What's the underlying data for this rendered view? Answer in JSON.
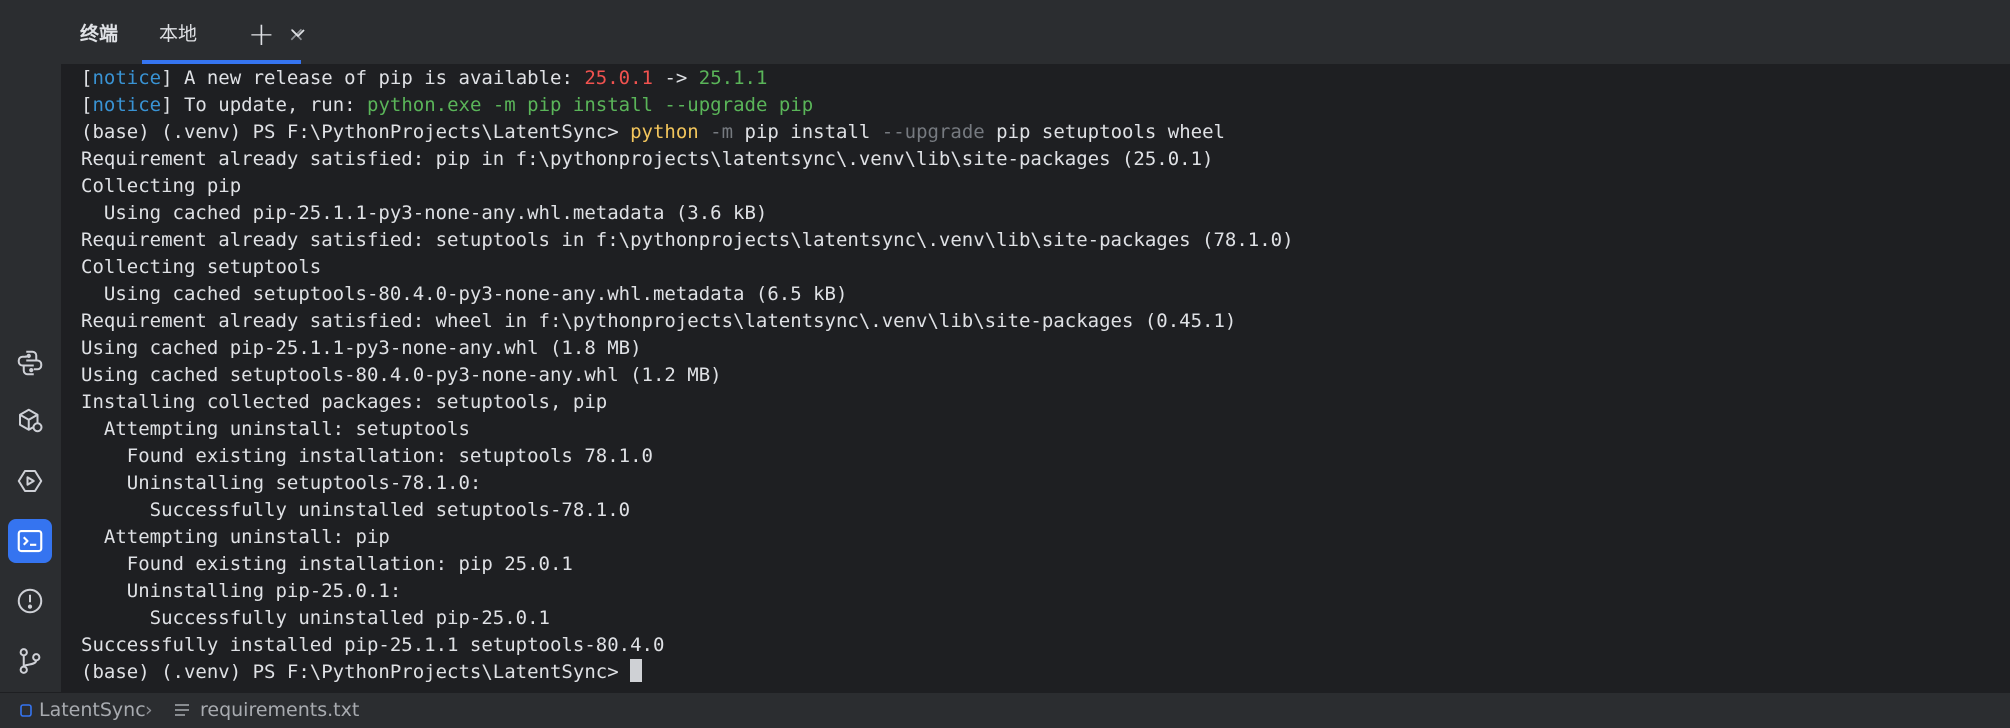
{
  "header": {
    "title": "终端",
    "tab_label": "本地",
    "tab_close": "×",
    "new_tab": "+",
    "dropdown": "⌄"
  },
  "terminal": {
    "notice1": {
      "open": "[",
      "word": "notice",
      "close": "]",
      "text": " A new release of pip is available: ",
      "old": "25.0.1",
      "arrow": " -> ",
      "new": "25.1.1"
    },
    "notice2": {
      "open": "[",
      "word": "notice",
      "close": "]",
      "text": " To update, run: ",
      "cmd": "python.exe -m pip install --upgrade pip"
    },
    "cmd_line": {
      "prompt": "(base) (.venv) PS F:\\PythonProjects\\LatentSync> ",
      "python": "python",
      "sp1": " ",
      "flag_m": "-m",
      "mid": " pip install ",
      "flag_upgrade": "--upgrade",
      "rest": " pip setuptools wheel"
    },
    "lines": [
      "Requirement already satisfied: pip in f:\\pythonprojects\\latentsync\\.venv\\lib\\site-packages (25.0.1)",
      "Collecting pip",
      "  Using cached pip-25.1.1-py3-none-any.whl.metadata (3.6 kB)",
      "Requirement already satisfied: setuptools in f:\\pythonprojects\\latentsync\\.venv\\lib\\site-packages (78.1.0)",
      "Collecting setuptools",
      "  Using cached setuptools-80.4.0-py3-none-any.whl.metadata (6.5 kB)",
      "Requirement already satisfied: wheel in f:\\pythonprojects\\latentsync\\.venv\\lib\\site-packages (0.45.1)",
      "Using cached pip-25.1.1-py3-none-any.whl (1.8 MB)",
      "Using cached setuptools-80.4.0-py3-none-any.whl (1.2 MB)",
      "Installing collected packages: setuptools, pip",
      "  Attempting uninstall: setuptools",
      "    Found existing installation: setuptools 78.1.0",
      "    Uninstalling setuptools-78.1.0:",
      "      Successfully uninstalled setuptools-78.1.0",
      "  Attempting uninstall: pip",
      "    Found existing installation: pip 25.0.1",
      "    Uninstalling pip-25.0.1:",
      "      Successfully uninstalled pip-25.0.1",
      "Successfully installed pip-25.1.1 setuptools-80.4.0"
    ],
    "final_prompt": "(base) (.venv) PS F:\\PythonProjects\\LatentSync> "
  },
  "sidebar": {
    "icons": [
      "python-packages-icon",
      "services-icon",
      "run-icon",
      "terminal-icon",
      "problems-icon",
      "git-icon"
    ]
  },
  "statusbar": {
    "project": "LatentSync",
    "separator": "›",
    "file": "requirements.txt"
  },
  "colors": {
    "accent": "#3574f0",
    "notice": "#3993d4",
    "old_version": "#f0524f",
    "new_version": "#5ab559",
    "command": "#f2c55c"
  }
}
